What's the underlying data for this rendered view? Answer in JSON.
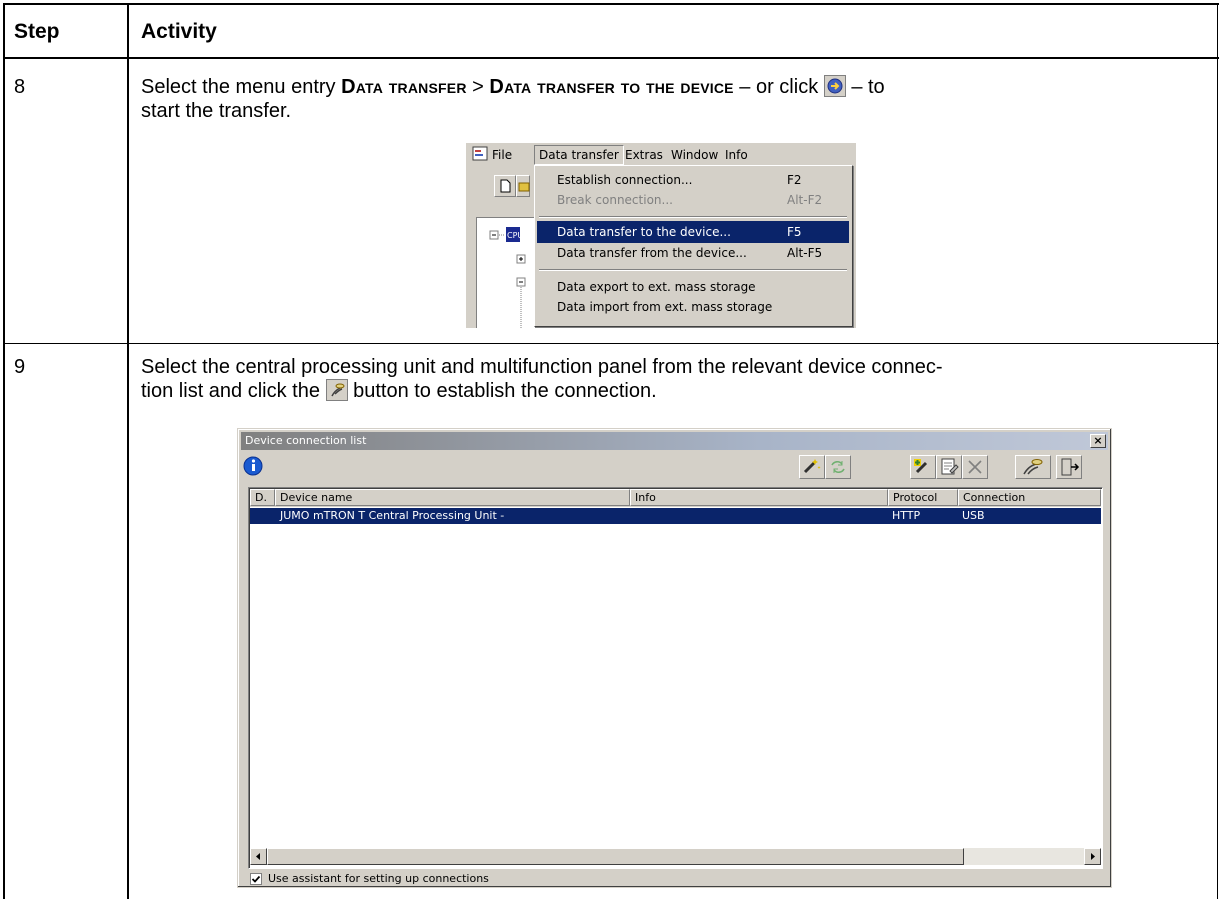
{
  "table": {
    "header_step": "Step",
    "header_activity": "Activity"
  },
  "row8": {
    "step": "8",
    "text_1": "Select the menu entry ",
    "menu_1": "Data transfer",
    "sep": " > ",
    "menu_2": "Data transfer to the device",
    "text_2": " – or click ",
    "text_3": " – to",
    "text_4": "start the transfer."
  },
  "menu_screenshot": {
    "menubar": [
      "File",
      "Data transfer",
      "Extras",
      "Window",
      "Info"
    ],
    "tree_label": "CPU",
    "items": [
      {
        "label": "Establish connection...",
        "key": "F2",
        "state": "normal"
      },
      {
        "label": "Break connection...",
        "key": "Alt-F2",
        "state": "disabled"
      },
      {
        "label": "Data transfer to the device...",
        "key": "F5",
        "state": "selected"
      },
      {
        "label": "Data transfer from the device...",
        "key": "Alt-F5",
        "state": "normal"
      },
      {
        "label": "Data export to ext. mass storage",
        "key": "",
        "state": "normal"
      },
      {
        "label": "Data import from ext. mass storage",
        "key": "",
        "state": "normal"
      }
    ]
  },
  "row9": {
    "step": "9",
    "line_1": "Select the central processing unit and multifunction panel from the relevant device connec-",
    "line_2a": "tion list and click the ",
    "line_2b": " button to establish the connection."
  },
  "dialog": {
    "title": "Device connection list",
    "close": "×",
    "columns": [
      "D.",
      "Device name",
      "Info",
      "Protocol",
      "Connection"
    ],
    "row": {
      "device_name": "JUMO mTRON T Central Processing Unit -",
      "info": "",
      "protocol": "HTTP",
      "connection": "USB"
    },
    "checkbox_checked": true,
    "checkbox_label": "Use assistant for setting up connections"
  },
  "colors": {
    "selection": "#0a246a",
    "win_face": "#d4d0c8"
  }
}
